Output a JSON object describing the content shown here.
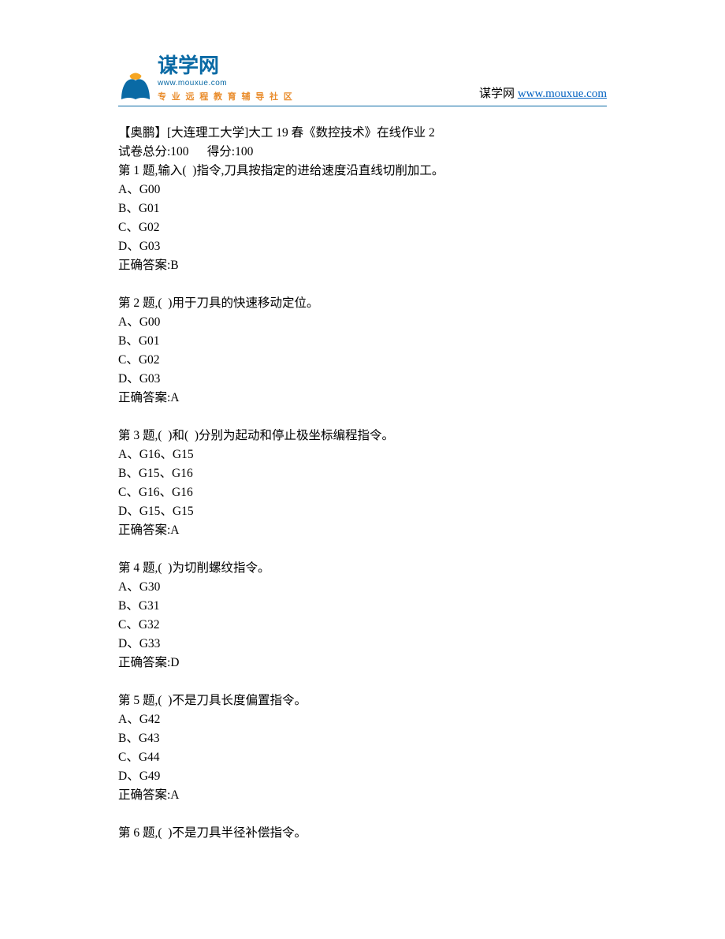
{
  "header": {
    "logo_main": "谋学网",
    "logo_url_small": "www.mouxue.com",
    "logo_tagline": "专 业 远 程 教 育 辅 导 社 区",
    "brand_label": "谋学网",
    "brand_url": "www.mouxue.com"
  },
  "intro": {
    "title": "【奥鹏】[大连理工大学]大工 19 春《数控技术》在线作业 2",
    "score_line": "试卷总分:100      得分:100"
  },
  "questions": [
    {
      "stem": "第 1 题,输入(  )指令,刀具按指定的进给速度沿直线切削加工。",
      "options": [
        "A、G00",
        "B、G01",
        "C、G02",
        "D、G03"
      ],
      "answer": "正确答案:B"
    },
    {
      "stem": "第 2 题,(  )用于刀具的快速移动定位。",
      "options": [
        "A、G00",
        "B、G01",
        "C、G02",
        "D、G03"
      ],
      "answer": "正确答案:A"
    },
    {
      "stem": "第 3 题,(  )和(  )分别为起动和停止极坐标编程指令。",
      "options": [
        "A、G16、G15",
        "B、G15、G16",
        "C、G16、G16",
        "D、G15、G15"
      ],
      "answer": "正确答案:A"
    },
    {
      "stem": "第 4 题,(  )为切削螺纹指令。",
      "options": [
        "A、G30",
        "B、G31",
        "C、G32",
        "D、G33"
      ],
      "answer": "正确答案:D"
    },
    {
      "stem": "第 5 题,(  )不是刀具长度偏置指令。",
      "options": [
        "A、G42",
        "B、G43",
        "C、G44",
        "D、G49"
      ],
      "answer": "正确答案:A"
    },
    {
      "stem": "第 6 题,(  )不是刀具半径补偿指令。",
      "options": [],
      "answer": ""
    }
  ]
}
